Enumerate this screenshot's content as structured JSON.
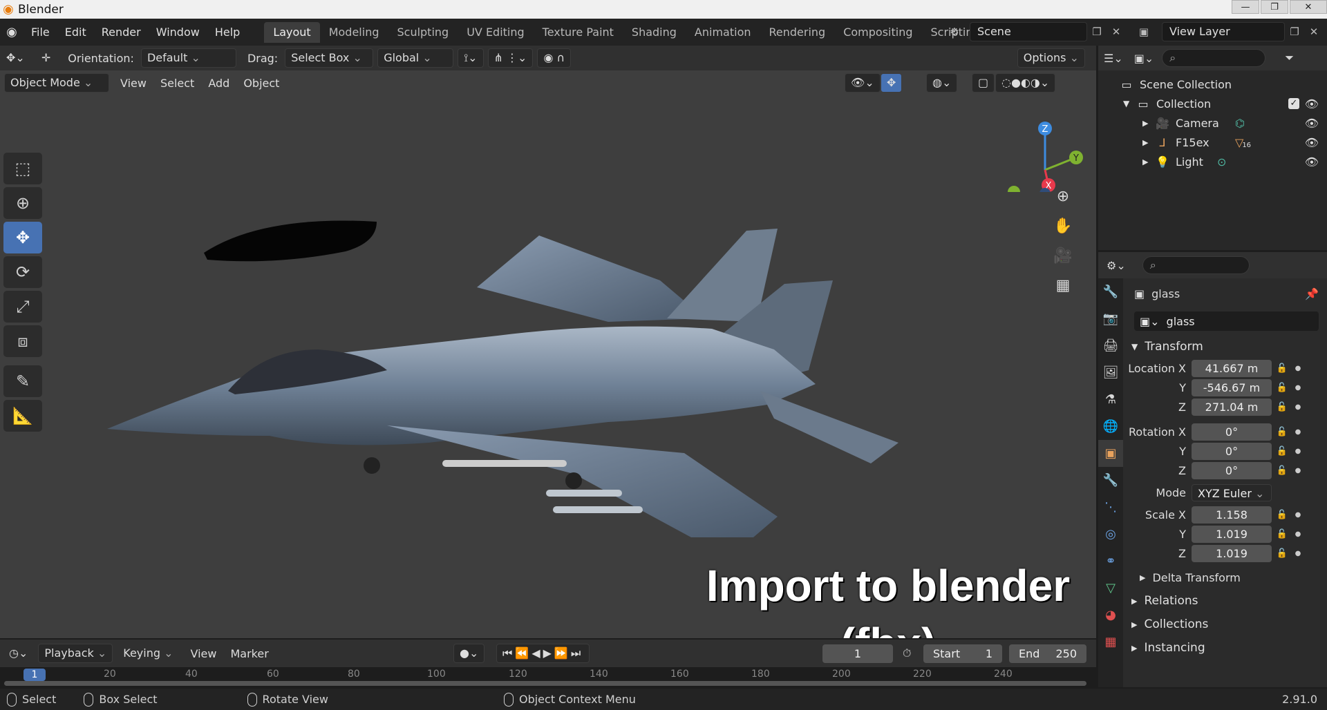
{
  "window": {
    "title": "Blender",
    "min": "—",
    "max": "❐",
    "close": "✕"
  },
  "menu": [
    "File",
    "Edit",
    "Render",
    "Window",
    "Help"
  ],
  "workspaces": [
    "Layout",
    "Modeling",
    "Sculpting",
    "UV Editing",
    "Texture Paint",
    "Shading",
    "Animation",
    "Rendering",
    "Compositing",
    "Scripting"
  ],
  "active_workspace": "Layout",
  "scene": "Scene",
  "view_layer": "View Layer",
  "header": {
    "orientation_label": "Orientation:",
    "orientation_value": "Default",
    "drag_label": "Drag:",
    "drag_value": "Select Box",
    "transform_space": "Global",
    "options": "Options"
  },
  "viewport_header": {
    "mode": "Object Mode",
    "menus": [
      "View",
      "Select",
      "Add",
      "Object"
    ]
  },
  "gizmo": {
    "x": "X",
    "y": "Y",
    "z": "Z"
  },
  "overlay": {
    "line1": "Import to blender",
    "line2": "(fbx)"
  },
  "outliner": {
    "root": "Scene Collection",
    "collection": "Collection",
    "items": [
      {
        "name": "Camera"
      },
      {
        "name": "F15ex",
        "badge": "16"
      },
      {
        "name": "Light"
      }
    ]
  },
  "properties": {
    "object_name": "glass",
    "object_field": "glass",
    "transform_title": "Transform",
    "location": {
      "label": "Location X",
      "x": "41.667 m",
      "y": "-546.67 m",
      "z": "271.04 m"
    },
    "rotation": {
      "label": "Rotation X",
      "x": "0°",
      "y": "0°",
      "z": "0°"
    },
    "mode_label": "Mode",
    "mode_value": "XYZ Euler",
    "scale": {
      "label": "Scale X",
      "x": "1.158",
      "y": "1.019",
      "z": "1.019"
    },
    "axis_y": "Y",
    "axis_z": "Z",
    "subpanels": [
      "Delta Transform",
      "Relations",
      "Collections",
      "Instancing"
    ]
  },
  "timeline": {
    "menus": [
      "Playback",
      "Keying",
      "View",
      "Marker"
    ],
    "current_frame": "1",
    "start_label": "Start",
    "start": "1",
    "end_label": "End",
    "end": "250",
    "ticks": [
      "1",
      "20",
      "40",
      "60",
      "80",
      "100",
      "120",
      "140",
      "160",
      "180",
      "200",
      "220",
      "240"
    ]
  },
  "status": {
    "select": "Select",
    "box_select": "Box Select",
    "rotate": "Rotate View",
    "context": "Object Context Menu",
    "version": "2.91.0"
  },
  "colors": {
    "accent": "#4772b3",
    "x_axis": "#e8394c",
    "y_axis": "#7fb230",
    "z_axis": "#3d8ce0"
  }
}
